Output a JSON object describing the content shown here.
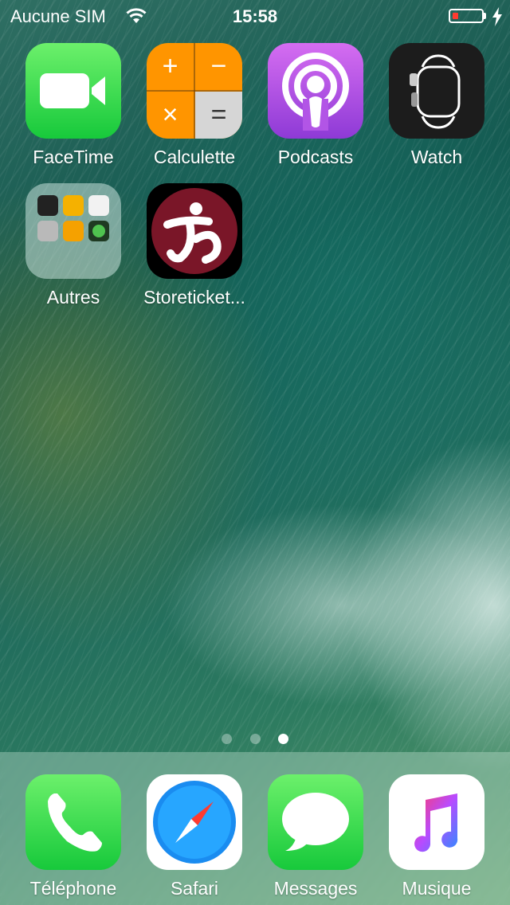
{
  "status_bar": {
    "carrier": "Aucune SIM",
    "time": "15:58",
    "battery_color": "#ff3b30"
  },
  "home_apps": [
    {
      "label": "FaceTime",
      "icon": "facetime-icon"
    },
    {
      "label": "Calculette",
      "icon": "calculator-icon"
    },
    {
      "label": "Podcasts",
      "icon": "podcasts-icon"
    },
    {
      "label": "Watch",
      "icon": "watch-icon"
    },
    {
      "label": "Autres",
      "icon": "folder-icon"
    },
    {
      "label": "Storeticket...",
      "icon": "storeticket-icon"
    }
  ],
  "calculator_symbols": [
    "+",
    "−",
    "×",
    "="
  ],
  "page_indicator": {
    "pages": 3,
    "current": 3
  },
  "dock_apps": [
    {
      "label": "Téléphone",
      "icon": "phone-icon"
    },
    {
      "label": "Safari",
      "icon": "safari-icon"
    },
    {
      "label": "Messages",
      "icon": "messages-icon"
    },
    {
      "label": "Musique",
      "icon": "music-icon"
    }
  ]
}
